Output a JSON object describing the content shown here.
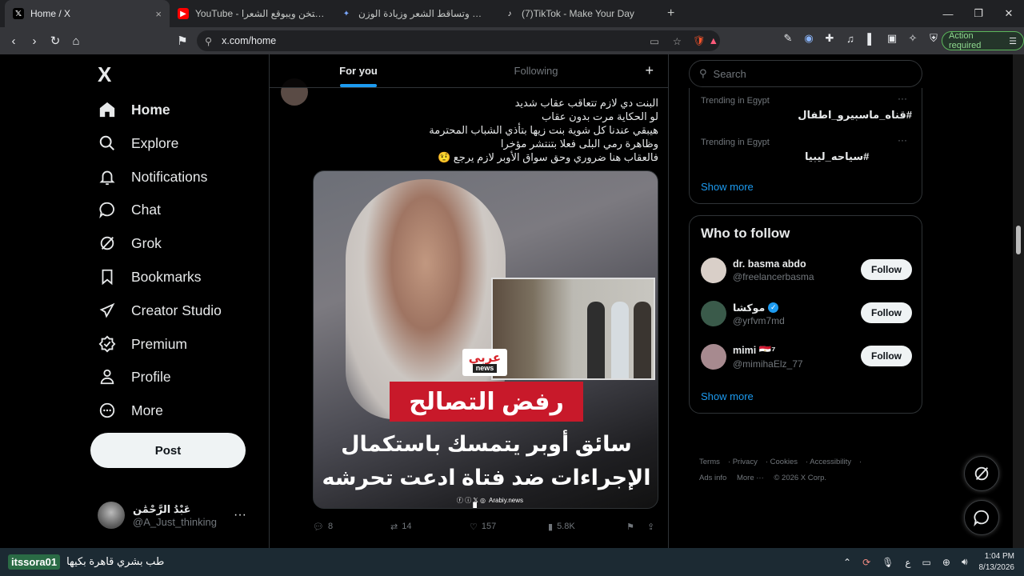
{
  "browser": {
    "tabs": [
      {
        "title": "Home / X",
        "close": "×"
      },
      {
        "title": "YouTube - الحجاب بيتخن ويبوقع الشعرا"
      },
      {
        "title": "الحجاب وتساقط الشعر وزيادة الوزن - Ai"
      },
      {
        "title": "(7)TikTok - Make Your Day"
      }
    ],
    "new_tab": "+",
    "url": "x.com/home",
    "action_required": "Action required"
  },
  "sidebar": {
    "logo": "X",
    "items": [
      {
        "label": "Home",
        "icon": "home-icon"
      },
      {
        "label": "Explore",
        "icon": "search-icon"
      },
      {
        "label": "Notifications",
        "icon": "bell-icon"
      },
      {
        "label": "Chat",
        "icon": "chat-icon"
      },
      {
        "label": "Grok",
        "icon": "grok-icon"
      },
      {
        "label": "Bookmarks",
        "icon": "bookmark-icon"
      },
      {
        "label": "Creator Studio",
        "icon": "rocket-icon"
      },
      {
        "label": "Premium",
        "icon": "verified-icon"
      },
      {
        "label": "Profile",
        "icon": "person-icon"
      },
      {
        "label": "More",
        "icon": "more-circle-icon"
      }
    ],
    "post_label": "Post",
    "account": {
      "name": "عَبْدُ الرَّحْمَٰن",
      "handle": "@A_Just_thinking",
      "menu": "···"
    }
  },
  "feed": {
    "tabs": [
      "For you",
      "Following"
    ],
    "add": "+",
    "tweet": {
      "lines": [
        "البنت دي لازم تتعاقب عقاب شديد",
        "لو الحكاية مرت بدون عقاب",
        "هيبقي عندنا كل شوية بنت زيها بتأذي الشباب المحترمة",
        "وظاهرة رمي البلى فعلا بتنتشر مؤخرا",
        "فالعقاب هنا ضروري وحق سواق الأوبر لازم يرجع 🤨"
      ],
      "media": {
        "badge_ar": "عربي",
        "badge_en": "news",
        "band": "رفض التصالح",
        "headline_1": "سائق أوبر يتمسك باستكمال",
        "headline_2": "الإجراءات ضد فتاة ادعت تحرشه بها",
        "source": "Arabiy.news"
      },
      "stats": {
        "replies": "8",
        "reposts": "14",
        "likes": "157",
        "views": "5.8K"
      }
    }
  },
  "right": {
    "search_placeholder": "Search",
    "trends": [
      {
        "meta": "Trending in Egypt",
        "tag": "#قناه_ماسبيرو_اطفال"
      },
      {
        "meta": "Trending in Egypt",
        "tag": "#سياحه_ليبيا"
      }
    ],
    "trends_more": "Show more",
    "who_to_follow": {
      "title": "Who to follow",
      "people": [
        {
          "name": "dr. basma abdo",
          "handle": "@freelancerbasma",
          "badge": "",
          "avatar_color": "#d9cfc8"
        },
        {
          "name": "موكشا",
          "handle": "@yrfvm7md",
          "badge": "✓",
          "avatar_color": "#3a5a4a"
        },
        {
          "name": "mimi 🇪🇬⁷",
          "handle": "@mimihaElz_77",
          "badge": "",
          "avatar_color": "#a78a8f"
        }
      ],
      "follow_label": "Follow",
      "more": "Show more"
    },
    "footer": [
      "Terms",
      "Privacy",
      "Cookies",
      "Accessibility",
      "Ads info",
      "More ···",
      "© 2026 X Corp."
    ]
  },
  "taskbar": {
    "channel": "itssora01",
    "stream_text": "طب بشري قاهرة بكيها",
    "lang": "ع",
    "time": "1:04 PM",
    "date": "8/13/2026"
  }
}
